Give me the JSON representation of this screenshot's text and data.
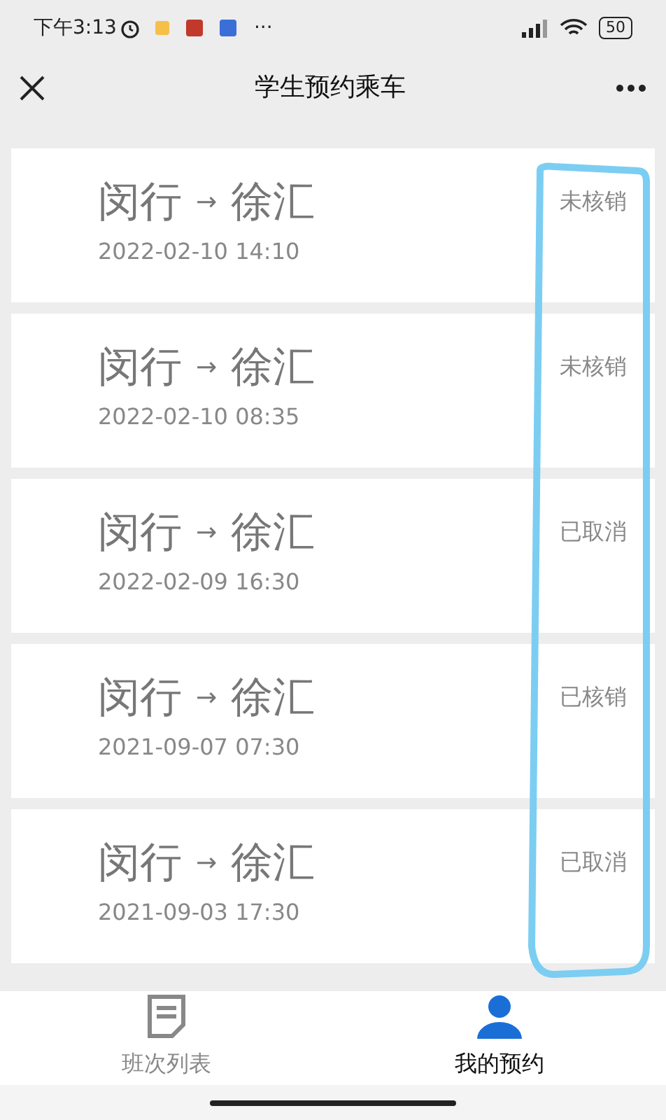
{
  "status_bar": {
    "time": "下午3:13",
    "more": "···",
    "battery": "50"
  },
  "header": {
    "title": "学生预约乘车"
  },
  "trips": [
    {
      "route_from": "闵行",
      "arrow": "→",
      "route_to": "徐汇",
      "datetime": "2022-02-10 14:10",
      "status": "未核销"
    },
    {
      "route_from": "闵行",
      "arrow": "→",
      "route_to": "徐汇",
      "datetime": "2022-02-10 08:35",
      "status": "未核销"
    },
    {
      "route_from": "闵行",
      "arrow": "→",
      "route_to": "徐汇",
      "datetime": "2022-02-09 16:30",
      "status": "已取消"
    },
    {
      "route_from": "闵行",
      "arrow": "→",
      "route_to": "徐汇",
      "datetime": "2021-09-07 07:30",
      "status": "已核销"
    },
    {
      "route_from": "闵行",
      "arrow": "→",
      "route_to": "徐汇",
      "datetime": "2021-09-03 17:30",
      "status": "已取消"
    }
  ],
  "tabs": [
    {
      "label": "班次列表",
      "kind": "list",
      "selected": false
    },
    {
      "label": "我的预约",
      "kind": "person",
      "selected": true
    }
  ]
}
